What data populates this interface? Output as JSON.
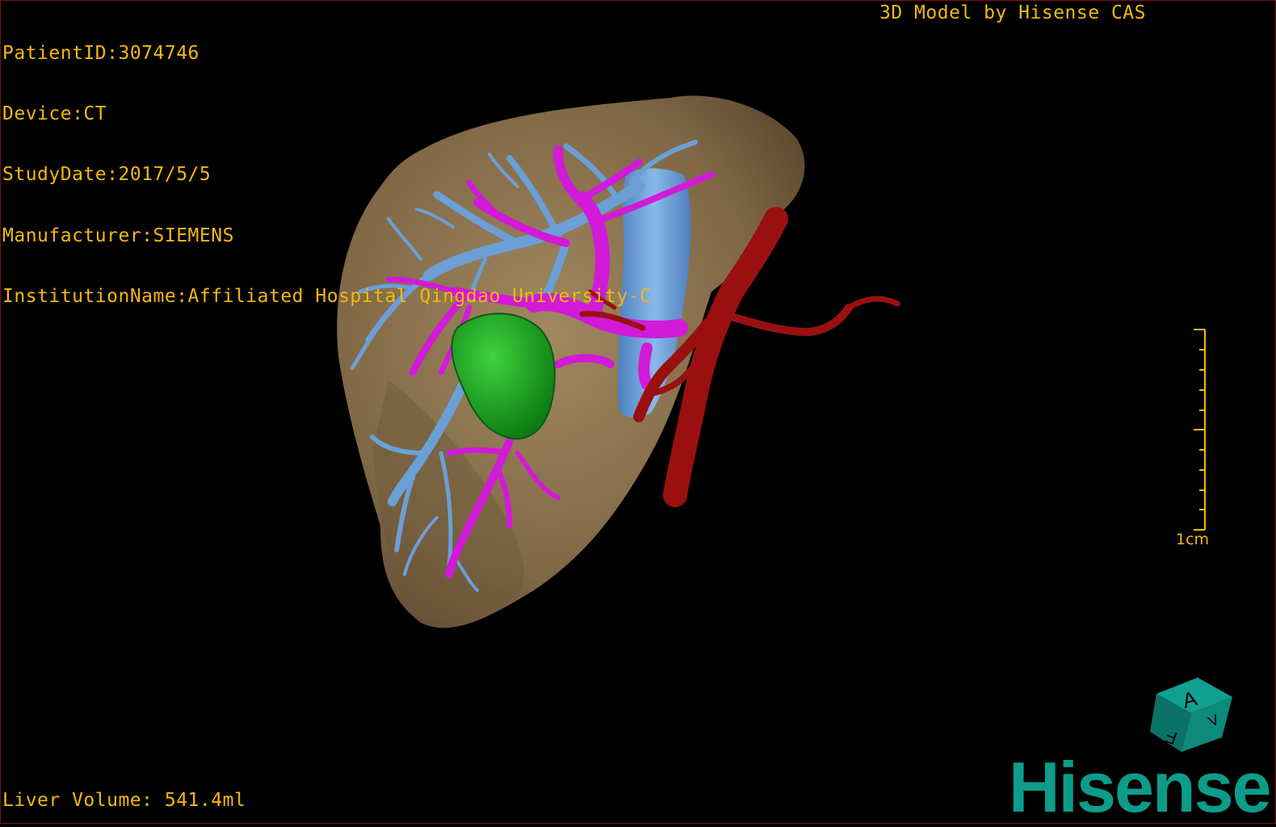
{
  "info": {
    "patient_id": "PatientID:3074746",
    "device": "Device:CT",
    "study_date": "StudyDate:2017/5/5",
    "manufacturer": "Manufacturer:SIEMENS",
    "institution": "InstitutionName:Affiliated Hospital Qingdao University-C"
  },
  "brand_title": "3D Model by Hisense CAS",
  "liver_volume": "Liver Volume: 541.4ml",
  "scale_label": "1cm",
  "cube": {
    "face_top": "A",
    "face_front": "F",
    "face_side": "V"
  },
  "logo": "Hisense",
  "colors": {
    "overlay_text": "#f2b90c",
    "liver": "#8c7452",
    "hepatic_vein": "#6b9fd6",
    "portal_vein": "#d21ad8",
    "artery": "#9a1010",
    "tumor": "#1a9a1a",
    "logo": "#0d9c8a"
  }
}
